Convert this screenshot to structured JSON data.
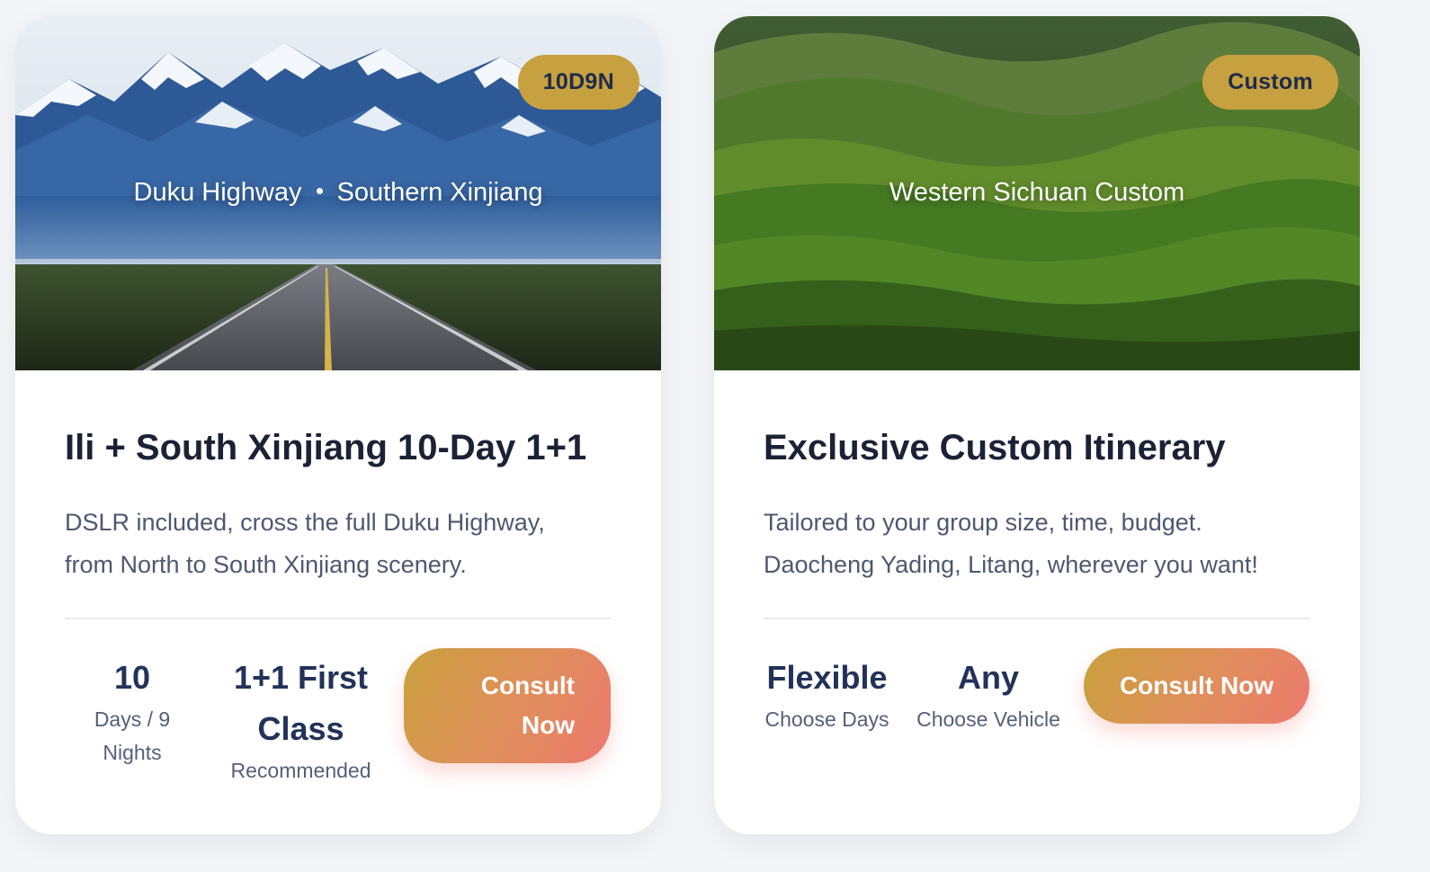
{
  "cards": [
    {
      "badge": "10D9N",
      "hero_label_left": "Duku Highway",
      "hero_label_right": "Southern Xinjiang",
      "title": "Ili + South Xinjiang 10-Day 1+1",
      "description_line1": "DSLR included, cross the full Duku Highway,",
      "description_line2": "from North to South Xinjiang scenery.",
      "stat1_value": "10",
      "stat1_sub_line1": "Days / 9",
      "stat1_sub_line2": "Nights",
      "stat2_value_line1": "1+1 First",
      "stat2_value_line2": "Class",
      "stat2_sub": "Recommended",
      "cta_line1": "Consult",
      "cta_line2": "Now"
    },
    {
      "badge": "Custom",
      "hero_label": "Western Sichuan Custom",
      "title": "Exclusive Custom Itinerary",
      "description_line1": "Tailored to your group size, time, budget.",
      "description_line2": "Daocheng Yading, Litang, wherever you want!",
      "stat1_value": "Flexible",
      "stat1_sub": "Choose Days",
      "stat2_value": "Any",
      "stat2_sub": "Choose Vehicle",
      "cta": "Consult Now"
    }
  ],
  "colors": {
    "badge": "#c7a03f",
    "title": "#1b2236",
    "stat_value": "#223259",
    "cta_start": "#c9a03d",
    "cta_end": "#ec7a6e"
  }
}
